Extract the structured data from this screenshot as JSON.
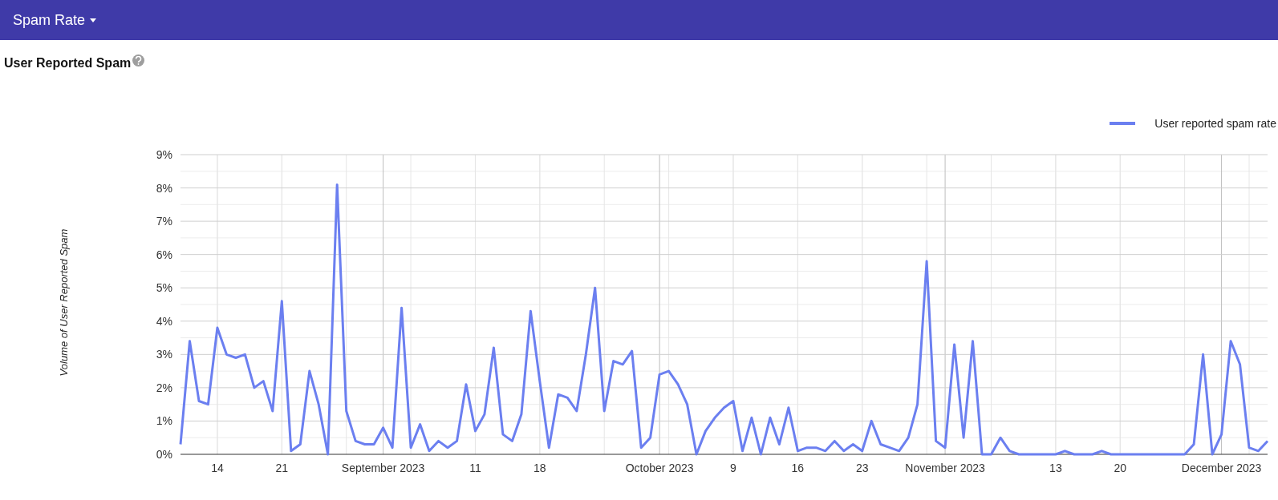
{
  "top_bar": {
    "menu_label": "Spam Rate"
  },
  "section": {
    "title": "User Reported Spam",
    "chart_data": {
      "type": "line",
      "ylabel": "Volume of User Reported Spam",
      "x": [
        "2023-08-10",
        "2023-08-11",
        "2023-08-12",
        "2023-08-13",
        "2023-08-14",
        "2023-08-15",
        "2023-08-16",
        "2023-08-17",
        "2023-08-18",
        "2023-08-19",
        "2023-08-20",
        "2023-08-21",
        "2023-08-22",
        "2023-08-23",
        "2023-08-24",
        "2023-08-25",
        "2023-08-26",
        "2023-08-27",
        "2023-08-28",
        "2023-08-29",
        "2023-08-30",
        "2023-08-31",
        "2023-09-01",
        "2023-09-02",
        "2023-09-03",
        "2023-09-04",
        "2023-09-05",
        "2023-09-06",
        "2023-09-07",
        "2023-09-08",
        "2023-09-09",
        "2023-09-10",
        "2023-09-11",
        "2023-09-12",
        "2023-09-13",
        "2023-09-14",
        "2023-09-15",
        "2023-09-16",
        "2023-09-17",
        "2023-09-18",
        "2023-09-19",
        "2023-09-20",
        "2023-09-21",
        "2023-09-22",
        "2023-09-23",
        "2023-09-24",
        "2023-09-25",
        "2023-09-26",
        "2023-09-27",
        "2023-09-28",
        "2023-09-29",
        "2023-09-30",
        "2023-10-01",
        "2023-10-02",
        "2023-10-03",
        "2023-10-04",
        "2023-10-05",
        "2023-10-06",
        "2023-10-07",
        "2023-10-08",
        "2023-10-09",
        "2023-10-10",
        "2023-10-11",
        "2023-10-12",
        "2023-10-13",
        "2023-10-14",
        "2023-10-15",
        "2023-10-16",
        "2023-10-17",
        "2023-10-18",
        "2023-10-19",
        "2023-10-20",
        "2023-10-21",
        "2023-10-22",
        "2023-10-23",
        "2023-10-24",
        "2023-10-25",
        "2023-10-26",
        "2023-10-27",
        "2023-10-28",
        "2023-10-29",
        "2023-10-30",
        "2023-10-31",
        "2023-11-01",
        "2023-11-02",
        "2023-11-03",
        "2023-11-04",
        "2023-11-05",
        "2023-11-06",
        "2023-11-07",
        "2023-11-08",
        "2023-11-09",
        "2023-11-10",
        "2023-11-11",
        "2023-11-12",
        "2023-11-13",
        "2023-11-14",
        "2023-11-15",
        "2023-11-16",
        "2023-11-17",
        "2023-11-18",
        "2023-11-19",
        "2023-11-20",
        "2023-11-21",
        "2023-11-22",
        "2023-11-23",
        "2023-11-24",
        "2023-11-25",
        "2023-11-26",
        "2023-11-27",
        "2023-11-28",
        "2023-11-29",
        "2023-11-30",
        "2023-12-01",
        "2023-12-02",
        "2023-12-03",
        "2023-12-04",
        "2023-12-05",
        "2023-12-06"
      ],
      "series": [
        {
          "name": "User reported spam rate",
          "color": "#6b7ff0",
          "values": [
            0.3,
            3.4,
            1.6,
            1.5,
            3.8,
            3.0,
            2.9,
            3.0,
            2.0,
            2.2,
            1.3,
            4.6,
            0.1,
            0.3,
            2.5,
            1.5,
            0.0,
            8.1,
            1.3,
            0.4,
            0.3,
            0.3,
            0.8,
            0.2,
            4.4,
            0.2,
            0.9,
            0.1,
            0.4,
            0.2,
            0.4,
            2.1,
            0.7,
            1.2,
            3.2,
            0.6,
            0.4,
            1.2,
            4.3,
            2.2,
            0.2,
            1.8,
            1.7,
            1.3,
            3.0,
            5.0,
            1.3,
            2.8,
            2.7,
            3.1,
            0.2,
            0.5,
            2.4,
            2.5,
            2.1,
            1.5,
            0.0,
            0.7,
            1.1,
            1.4,
            1.6,
            0.1,
            1.1,
            0.0,
            1.1,
            0.3,
            1.4,
            0.1,
            0.2,
            0.2,
            0.1,
            0.4,
            0.1,
            0.3,
            0.1,
            1.0,
            0.3,
            0.2,
            0.1,
            0.5,
            1.5,
            5.8,
            0.4,
            0.2,
            3.3,
            0.5,
            3.4,
            0.0,
            0.0,
            0.5,
            0.1,
            0.0,
            0.0,
            0.0,
            0.0,
            0.0,
            0.1,
            0.0,
            0.0,
            0.0,
            0.1,
            0.0,
            0.0,
            0.0,
            0.0,
            0.0,
            0.0,
            0.0,
            0.0,
            0.0,
            0.3,
            3.0,
            0.0,
            0.6,
            3.4,
            2.7,
            0.2,
            0.1,
            0.4
          ]
        }
      ],
      "ylim": [
        0,
        9
      ],
      "xlim": [
        "2023-08-10",
        "2023-12-06"
      ],
      "grid": true,
      "yticks": [
        {
          "value": 0,
          "label": "0%"
        },
        {
          "value": 1,
          "label": "1%"
        },
        {
          "value": 2,
          "label": "2%"
        },
        {
          "value": 3,
          "label": "3%"
        },
        {
          "value": 4,
          "label": "4%"
        },
        {
          "value": 5,
          "label": "5%"
        },
        {
          "value": 6,
          "label": "6%"
        },
        {
          "value": 7,
          "label": "7%"
        },
        {
          "value": 8,
          "label": "8%"
        },
        {
          "value": 9,
          "label": "9%"
        }
      ],
      "xticks": [
        {
          "value": "2023-08-14",
          "label": "14"
        },
        {
          "value": "2023-08-21",
          "label": "21"
        },
        {
          "value": "2023-09-01",
          "label": "September 2023"
        },
        {
          "value": "2023-09-11",
          "label": "11"
        },
        {
          "value": "2023-09-18",
          "label": "18"
        },
        {
          "value": "2023-10-01",
          "label": "October 2023"
        },
        {
          "value": "2023-10-09",
          "label": "9"
        },
        {
          "value": "2023-10-16",
          "label": "16"
        },
        {
          "value": "2023-10-23",
          "label": "23"
        },
        {
          "value": "2023-11-01",
          "label": "November 2023"
        },
        {
          "value": "2023-11-13",
          "label": "13"
        },
        {
          "value": "2023-11-20",
          "label": "20"
        },
        {
          "value": "2023-12-01",
          "label": "December 2023"
        }
      ]
    }
  }
}
